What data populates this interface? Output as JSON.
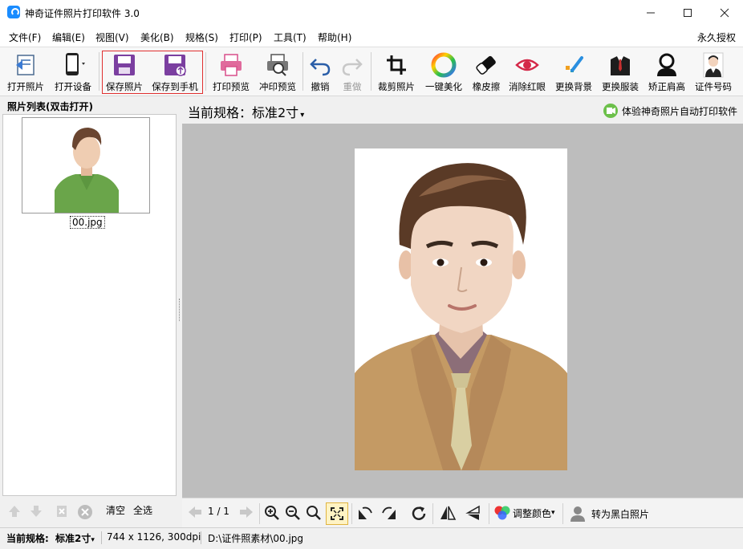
{
  "window": {
    "title": "神奇证件照片打印软件 3.0"
  },
  "menu": [
    "文件(F)",
    "编辑(E)",
    "视图(V)",
    "美化(B)",
    "规格(S)",
    "打印(P)",
    "工具(T)",
    "帮助(H)"
  ],
  "license": "永久授权",
  "toolbar": [
    {
      "label": "打开照片",
      "icon": "open-photo-icon"
    },
    {
      "label": "打开设备",
      "icon": "phone-device-icon"
    },
    {
      "label": "保存照片",
      "icon": "save-icon"
    },
    {
      "label": "保存到手机",
      "icon": "save-to-phone-icon"
    },
    {
      "label": "打印预览",
      "icon": "printer-icon"
    },
    {
      "label": "冲印预览",
      "icon": "print-preview-icon"
    },
    {
      "label": "撤销",
      "icon": "undo-icon"
    },
    {
      "label": "重做",
      "icon": "redo-icon"
    },
    {
      "label": "裁剪照片",
      "icon": "crop-icon"
    },
    {
      "label": "一键美化",
      "icon": "beautify-icon"
    },
    {
      "label": "橡皮擦",
      "icon": "eraser-icon"
    },
    {
      "label": "消除红眼",
      "icon": "eye-icon"
    },
    {
      "label": "更换背景",
      "icon": "background-icon"
    },
    {
      "label": "更换服装",
      "icon": "suit-icon"
    },
    {
      "label": "矫正肩高",
      "icon": "shoulder-icon"
    },
    {
      "label": "证件号码",
      "icon": "id-photo-icon"
    }
  ],
  "left_panel": {
    "title": "照片列表(双击打开)",
    "file": "00.jpg",
    "clear": "清空",
    "select_all": "全选"
  },
  "main": {
    "spec": "当前规格：标准2寸",
    "promo": "体验神奇照片自动打印软件",
    "page": "1 / 1",
    "adjust_color": "调整颜色",
    "to_bw": "转为黑白照片"
  },
  "status": {
    "spec_label": "当前规格:",
    "spec_value": "标准2寸",
    "dims": "744 x 1126, 300dpi",
    "path": "D:\\证件照素材\\00.jpg"
  },
  "colors": {
    "accent": "#7b3fa0",
    "highlight": "#e03030",
    "canvas": "#bdbdbd"
  }
}
